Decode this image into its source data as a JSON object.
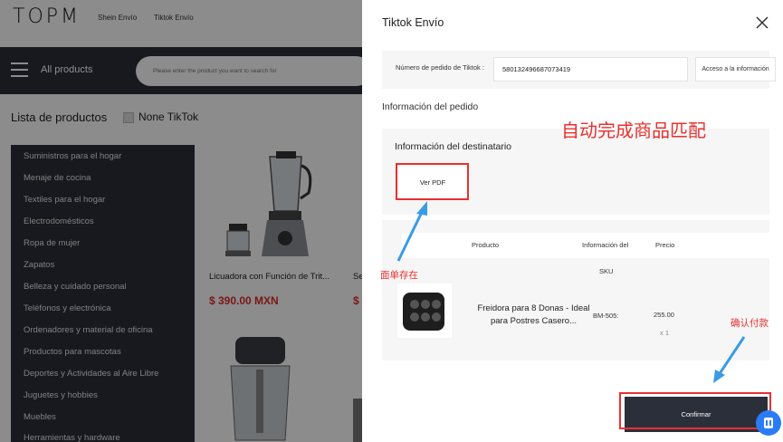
{
  "app": {
    "logo": "TOPM",
    "top_links": [
      "Shein Envío",
      "Tiktok Envío"
    ],
    "nav": {
      "label": "All products",
      "search_placeholder": "Please enter the product you want to search for"
    },
    "list_title": "Lista de productos",
    "filter_label": "None TikTok",
    "categories": [
      "Suministros para el hogar",
      "Menaje de cocina",
      "Textiles para el hogar",
      "Electrodomésticos",
      "Ropa de mujer",
      "Zapatos",
      "Belleza y cuidado personal",
      "Teléfonos y electrónica",
      "Ordenadores y material de oficina",
      "Productos para mascotas",
      "Deportes y Actividades al Aire Libre",
      "Juguetes y hobbies",
      "Muebles",
      "Herramientas y hardware"
    ],
    "products": [
      {
        "name": "Licuadora con Función de Trit...",
        "price": "$ 390.00 MXN"
      },
      {
        "name": "Se",
        "price": "$"
      }
    ]
  },
  "drawer": {
    "title": "Tiktok Envío",
    "order_label": "Número de pedido de Tiktok :",
    "order_value": "580132496687073419",
    "access_button": "Acceso a la información",
    "order_info_heading": "Información del pedido",
    "recipient_heading": "Información del destinatario",
    "pdf_button": "Ver PDF",
    "table_headers": {
      "product": "Producto",
      "info": "Información del",
      "sku": "SKU",
      "price": "Precio"
    },
    "item": {
      "name": "Freidora para 8 Donas - Ideal para Postres Casero...",
      "sku": "BM-505:",
      "price": "255.00",
      "qty": "x 1"
    },
    "confirm_button": "Confirmar"
  },
  "annotations": {
    "auto_match": "自动完成商品匹配",
    "pdf_note": "面单存在",
    "pay_note": "确认付款",
    "color": "#e8312f",
    "arrow_color": "#3a9be6"
  },
  "colors": {
    "dark": "#2b2f3a",
    "price_red": "#e02c2c",
    "chat_blue": "#2a7cf6"
  }
}
